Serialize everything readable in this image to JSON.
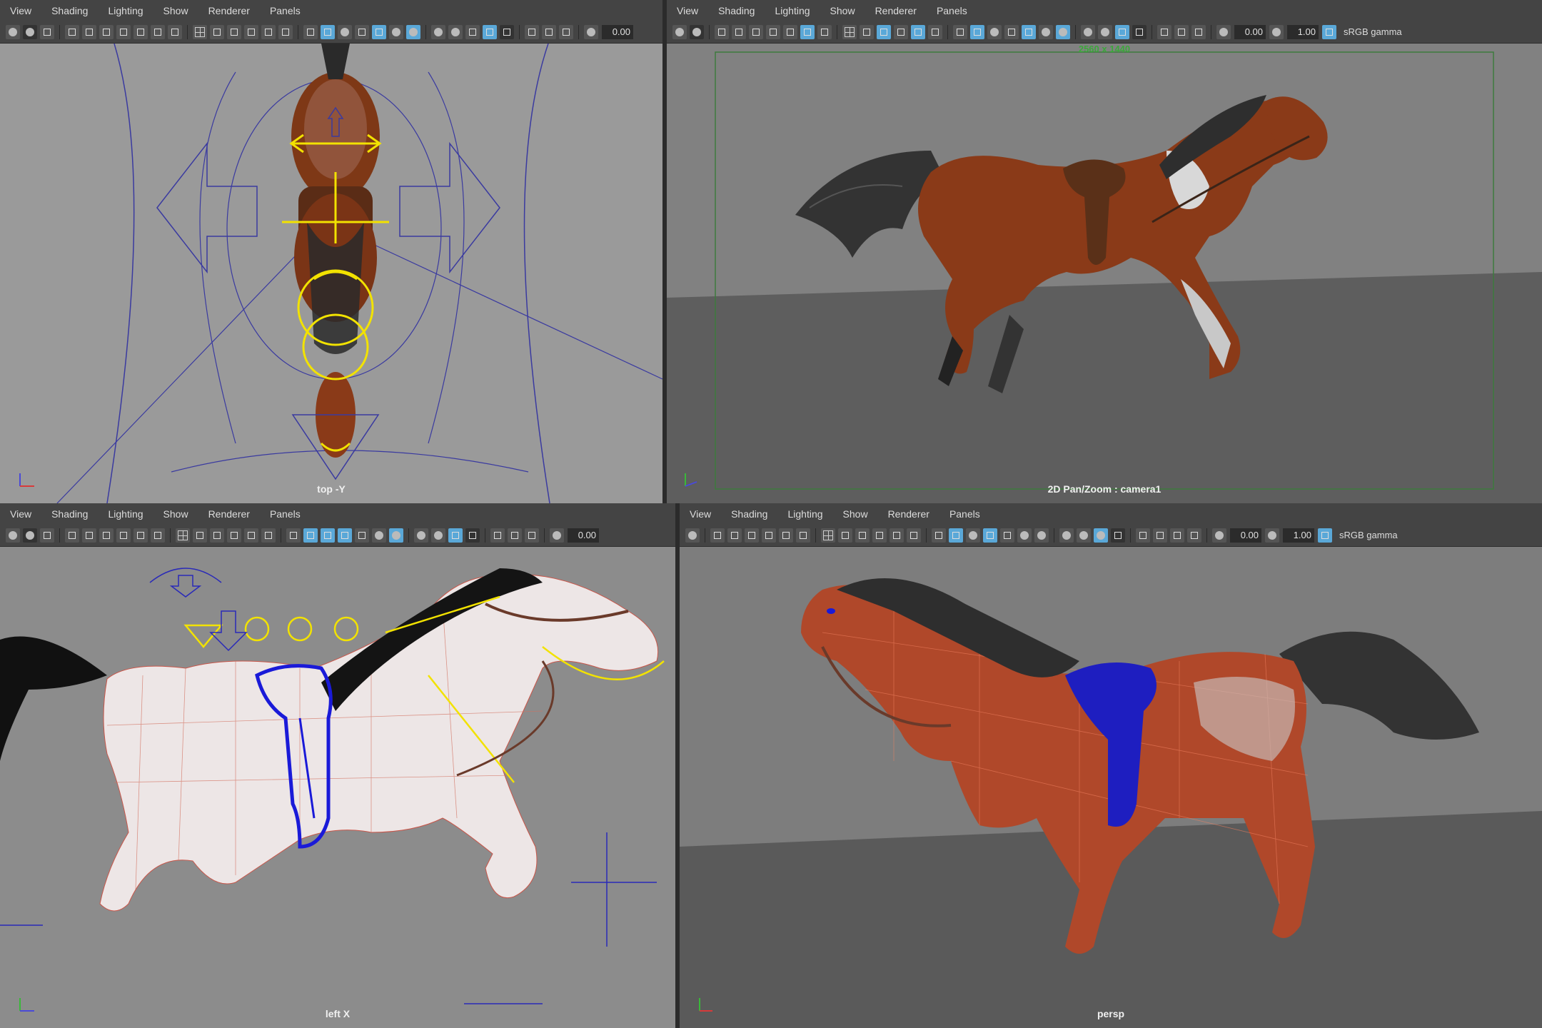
{
  "menu": [
    "View",
    "Shading",
    "Lighting",
    "Show",
    "Renderer",
    "Panels"
  ],
  "panels": {
    "top_left": {
      "camera_label": "top -Y",
      "exposure": "0.00"
    },
    "top_right": {
      "camera_label": "2D Pan/Zoom : camera1",
      "resolution": "2560 x 1440",
      "exposure": "0.00",
      "gamma": "1.00",
      "color_space": "sRGB gamma"
    },
    "bottom_left": {
      "camera_label": "left X",
      "exposure": "0.00"
    },
    "bottom_right": {
      "camera_label": "persp",
      "exposure": "0.00",
      "gamma": "1.00",
      "color_space": "sRGB gamma"
    }
  },
  "axis_letters": {
    "y": "y",
    "z": "z",
    "x": "x"
  },
  "colors": {
    "viewport_light": "#9c9c9c",
    "viewport_mid": "#858585",
    "floor": "#5e5e5e",
    "horse_body": "#8a3a18",
    "selection_yellow": "#f2e200",
    "rig_blue": "#2a2ab8",
    "saddle": "#5a3018",
    "mane": "#2a2a2a",
    "accent_toolbar": "#5aa8d8",
    "resolution_green": "#3ba83b"
  }
}
